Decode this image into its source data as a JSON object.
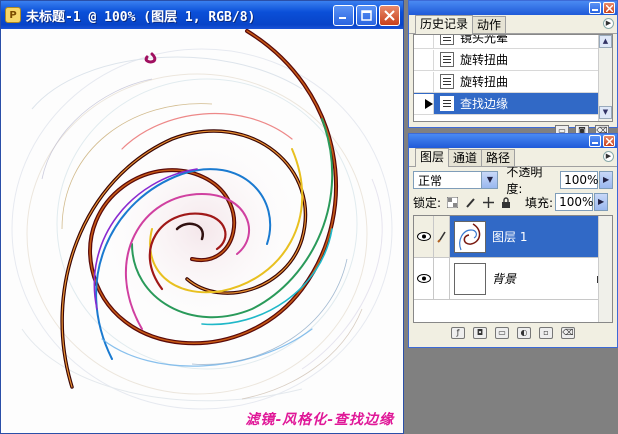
{
  "document": {
    "title": "未标题-1 @ 100% (图层 1, RGB/8)",
    "caption": "滤镜-风格化-查找边缘"
  },
  "history_palette": {
    "tabs": [
      "历史记录",
      "动作"
    ],
    "items": [
      {
        "label": "镜头光晕",
        "selected": false
      },
      {
        "label": "旋转扭曲",
        "selected": false
      },
      {
        "label": "旋转扭曲",
        "selected": false
      },
      {
        "label": "查找边缘",
        "selected": true
      }
    ]
  },
  "layers_palette": {
    "tabs": [
      "图层",
      "通道",
      "路径"
    ],
    "blend_mode": "正常",
    "opacity_label": "不透明度:",
    "opacity_value": "100%",
    "lock_label": "锁定:",
    "fill_label": "填充:",
    "fill_value": "100%",
    "layers": [
      {
        "name": "图层 1",
        "selected": true,
        "visible": true
      },
      {
        "name": "背景",
        "selected": false,
        "visible": true,
        "locked": true
      }
    ]
  },
  "colors": {
    "titlebar": "#0a4fd8",
    "selection": "#3169c6",
    "caption": "#e01898",
    "workspace": "#808080"
  }
}
